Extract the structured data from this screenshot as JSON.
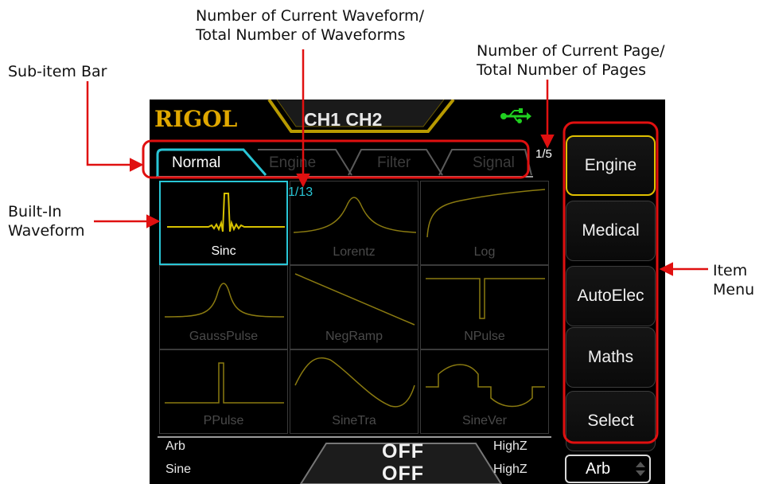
{
  "annotations": {
    "sub_item_bar": "Sub-item Bar",
    "waveform_count_line1": "Number of Current Waveform/",
    "waveform_count_line2": "Total Number of Waveforms",
    "page_count_line1": "Number of Current Page/",
    "page_count_line2": "Total Number of Pages",
    "builtin_line1": "Built-In",
    "builtin_line2": "Waveform",
    "item_line1": "Item",
    "item_line2": "Menu"
  },
  "screen": {
    "logo": "RIGOL",
    "channels": "CH1 CH2",
    "page_number": "1/5",
    "waveform_number": "1/13",
    "tabs": [
      {
        "label": "Normal"
      },
      {
        "label": "Engine"
      },
      {
        "label": "Filter"
      },
      {
        "label": "Signal"
      }
    ],
    "waveforms": [
      {
        "label": "Sinc",
        "selected": true
      },
      {
        "label": "Lorentz"
      },
      {
        "label": "Log"
      },
      {
        "label": "GaussPulse"
      },
      {
        "label": "NegRamp"
      },
      {
        "label": "NPulse"
      },
      {
        "label": "PPulse"
      },
      {
        "label": "SineTra"
      },
      {
        "label": "SineVer"
      }
    ],
    "menu": [
      {
        "label": "Engine",
        "active": true
      },
      {
        "label": "Medical"
      },
      {
        "label": "AutoElec"
      },
      {
        "label": "Maths"
      },
      {
        "label": "Select"
      }
    ],
    "bottom": {
      "ch1_type": "Arb",
      "ch2_type": "Sine",
      "ch1_output": "OFF",
      "ch2_output": "OFF",
      "ch1_load": "HighZ",
      "ch2_load": "HighZ",
      "selector": "Arb"
    }
  },
  "colors": {
    "accent_cyan": "#29c6d6",
    "accent_yellow": "#e0c000",
    "annotation_red": "#e01010",
    "waveform_trace": "#8a7a10"
  },
  "icons": [
    "usb-icon",
    "spin-arrows-icon"
  ]
}
